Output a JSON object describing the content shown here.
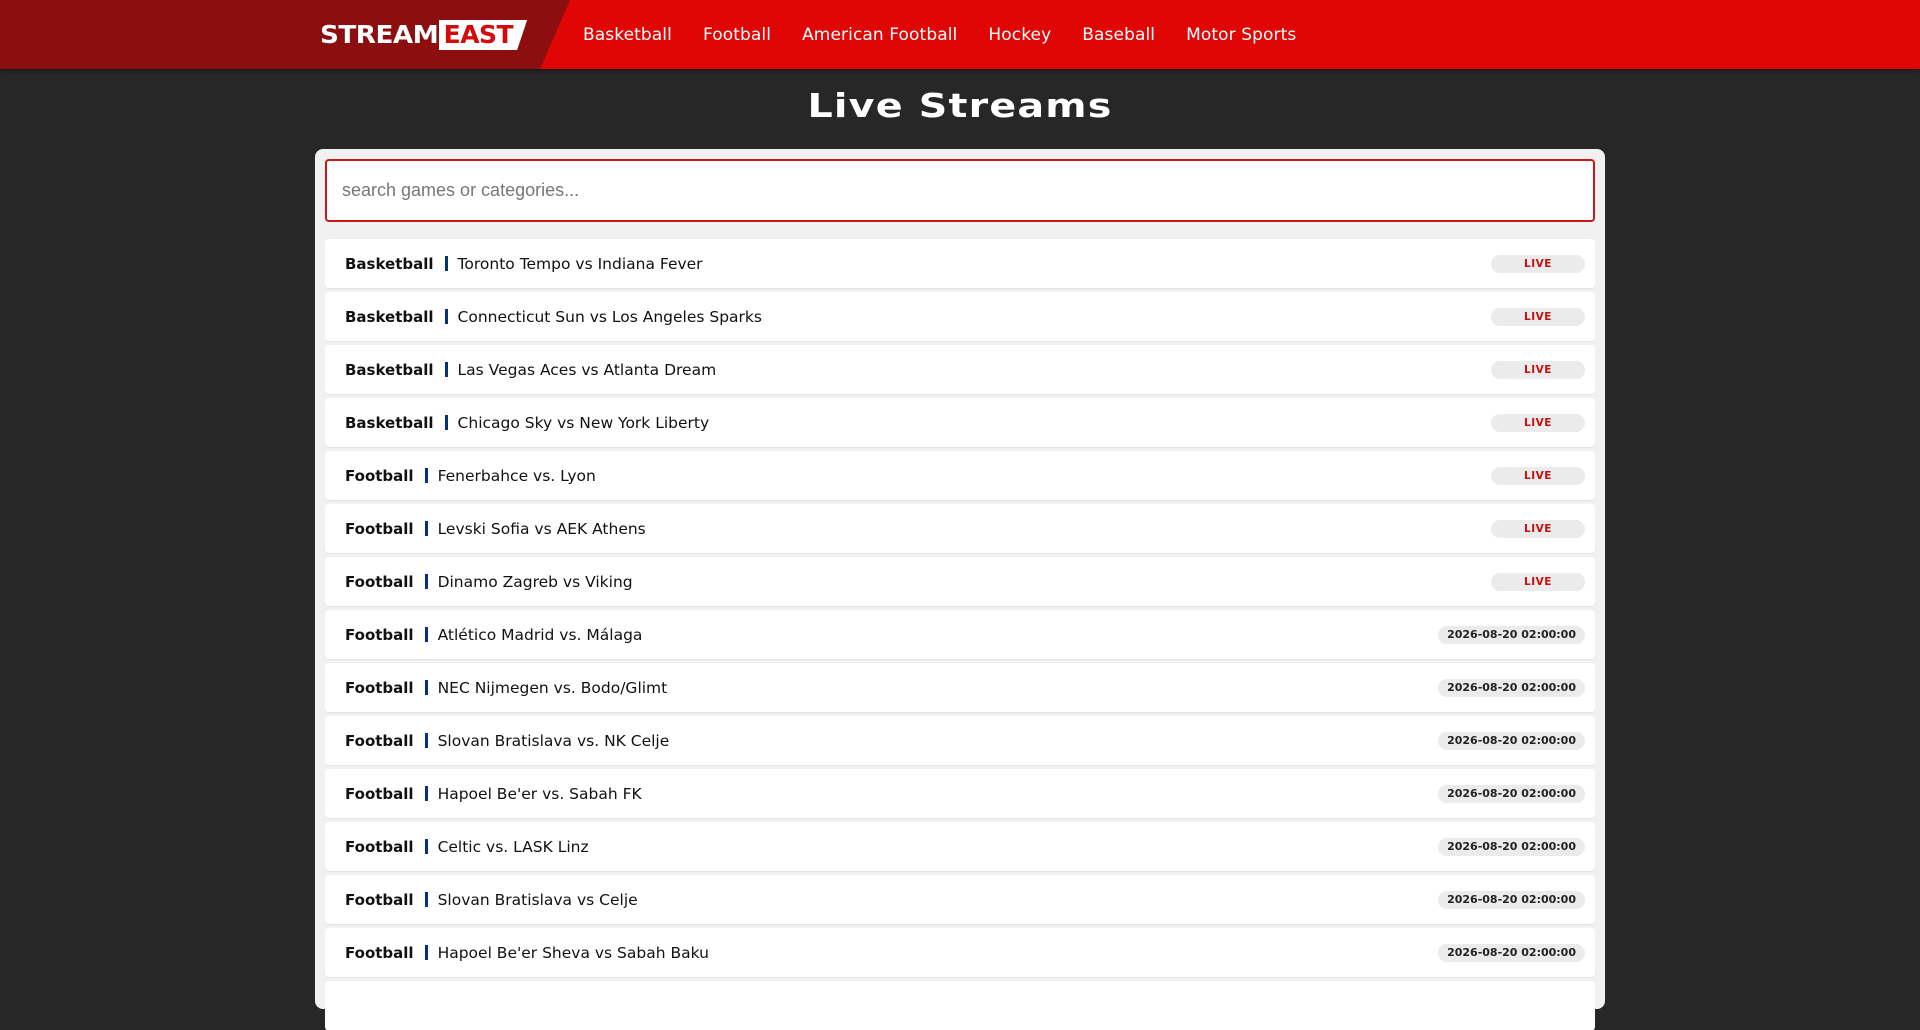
{
  "header": {
    "logo_left": "STREAM",
    "logo_right": "EAST",
    "nav": [
      "Basketball",
      "Football",
      "American Football",
      "Hockey",
      "Baseball",
      "Motor Sports"
    ]
  },
  "page": {
    "title": "Live Streams"
  },
  "search": {
    "placeholder": "search games or categories...",
    "value": ""
  },
  "events": [
    {
      "category": "Basketball",
      "title": "Toronto Tempo vs Indiana Fever",
      "status": "LIVE"
    },
    {
      "category": "Basketball",
      "title": "Connecticut Sun vs Los Angeles Sparks",
      "status": "LIVE"
    },
    {
      "category": "Basketball",
      "title": "Las Vegas Aces vs Atlanta Dream",
      "status": "LIVE"
    },
    {
      "category": "Basketball",
      "title": "Chicago Sky vs New York Liberty",
      "status": "LIVE"
    },
    {
      "category": "Football",
      "title": "Fenerbahce vs. Lyon",
      "status": "LIVE"
    },
    {
      "category": "Football",
      "title": "Levski Sofia vs AEK Athens",
      "status": "LIVE"
    },
    {
      "category": "Football",
      "title": "Dinamo Zagreb vs Viking",
      "status": "LIVE"
    },
    {
      "category": "Football",
      "title": "Atlético Madrid vs. Málaga",
      "status": "2026-08-20 02:00:00"
    },
    {
      "category": "Football",
      "title": "NEC Nijmegen vs. Bodo/Glimt",
      "status": "2026-08-20 02:00:00"
    },
    {
      "category": "Football",
      "title": "Slovan Bratislava vs. NK Celje",
      "status": "2026-08-20 02:00:00"
    },
    {
      "category": "Football",
      "title": "Hapoel Be'er vs. Sabah FK",
      "status": "2026-08-20 02:00:00"
    },
    {
      "category": "Football",
      "title": "Celtic vs. LASK Linz",
      "status": "2026-08-20 02:00:00"
    },
    {
      "category": "Football",
      "title": "Slovan Bratislava vs Celje",
      "status": "2026-08-20 02:00:00"
    },
    {
      "category": "Football",
      "title": "Hapoel Be'er Sheva vs Sabah Baku",
      "status": "2026-08-20 02:00:00"
    },
    {
      "category": "",
      "title": "",
      "status": ""
    }
  ],
  "colors": {
    "header_red": "#e00606",
    "header_dark_red": "#8d0e0e",
    "page_bg": "#272727",
    "panel_bg": "#f1f1f1",
    "live_text": "#c41010",
    "separator": "#0a2f7a"
  }
}
